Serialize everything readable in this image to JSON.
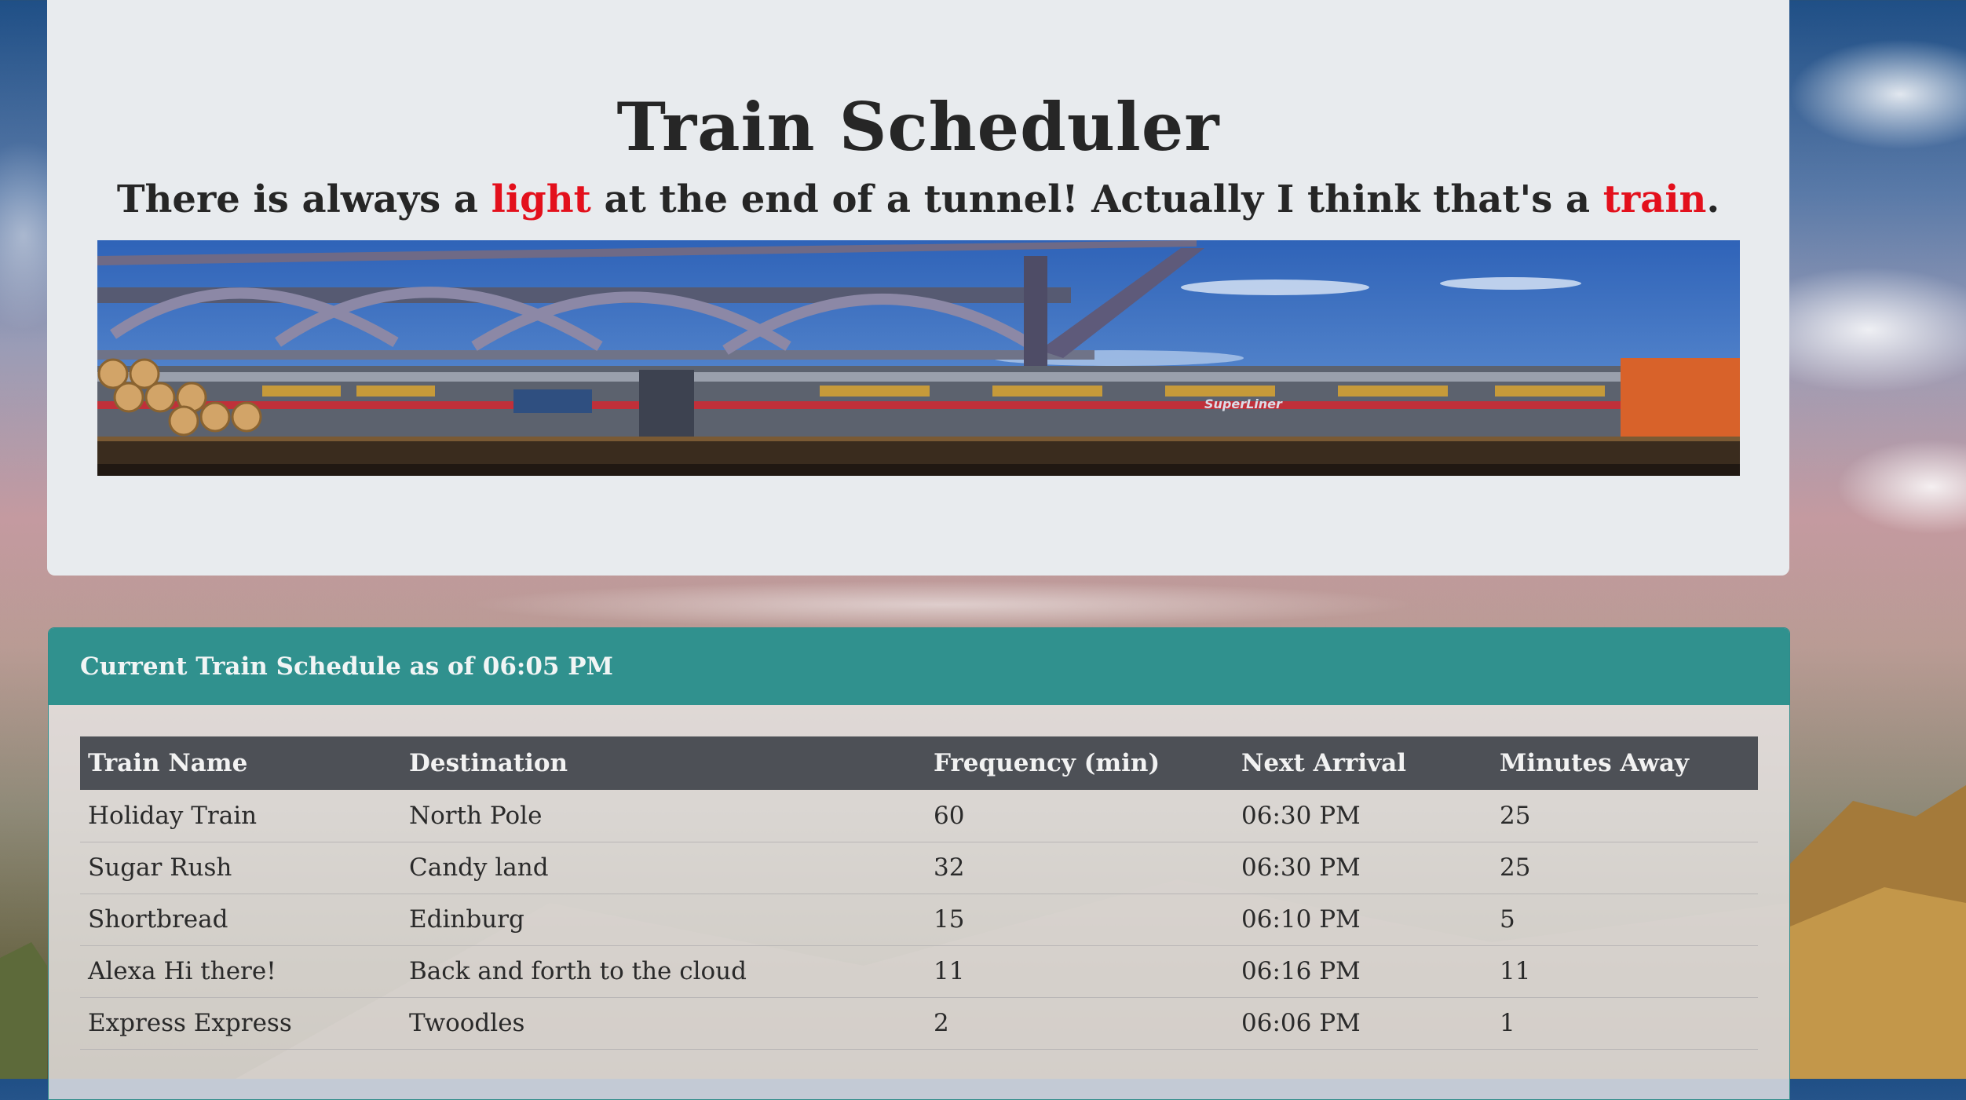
{
  "header": {
    "title": "Train Scheduler",
    "subtitle_part1": "There is always a ",
    "subtitle_highlight1": "light",
    "subtitle_part2": " at the end of a tunnel! Actually I think that's a ",
    "subtitle_highlight2": "train",
    "subtitle_part3": "."
  },
  "banner": {
    "train_label": "SuperLiner"
  },
  "schedule": {
    "heading": "Current Train Schedule as of 06:05 PM",
    "columns": [
      "Train Name",
      "Destination",
      "Frequency (min)",
      "Next Arrival",
      "Minutes Away"
    ],
    "rows": [
      [
        "Holiday Train",
        "North Pole",
        "60",
        "06:30 PM",
        "25"
      ],
      [
        "Sugar Rush",
        "Candy land",
        "32",
        "06:30 PM",
        "25"
      ],
      [
        "Shortbread",
        "Edinburg",
        "15",
        "06:10 PM",
        "5"
      ],
      [
        "Alexa Hi there!",
        "Back and forth to the cloud",
        "11",
        "06:16 PM",
        "11"
      ],
      [
        "Express Express",
        "Twoodles",
        "2",
        "06:06 PM",
        "1"
      ]
    ]
  },
  "colors": {
    "accent_red": "#e3101c",
    "panel_heading": "#30918e",
    "table_header": "#4d5056"
  }
}
